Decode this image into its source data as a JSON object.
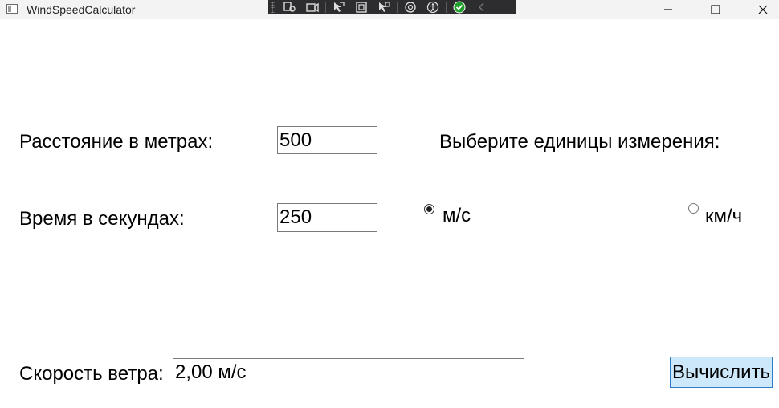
{
  "window": {
    "title": "WindSpeedCalculator"
  },
  "form": {
    "distance_label": "Расстояние в метрах:",
    "distance_value": "500",
    "time_label": "Время в секундах:",
    "time_value": "250",
    "units_label": "Выберите единицы измерения:",
    "unit_ms_label": "м/с",
    "unit_ms_checked": true,
    "unit_kmh_label": "км/ч",
    "unit_kmh_checked": false,
    "result_label": "Скорость ветра:",
    "result_value": "2,00 м/с",
    "calculate_label": "Вычислить"
  },
  "colors": {
    "button_bg": "#cde8fb",
    "button_border": "#2c7fc6",
    "debug_toolbar_bg": "#2d2d30",
    "titlebar_bg": "#f3f3f3"
  }
}
